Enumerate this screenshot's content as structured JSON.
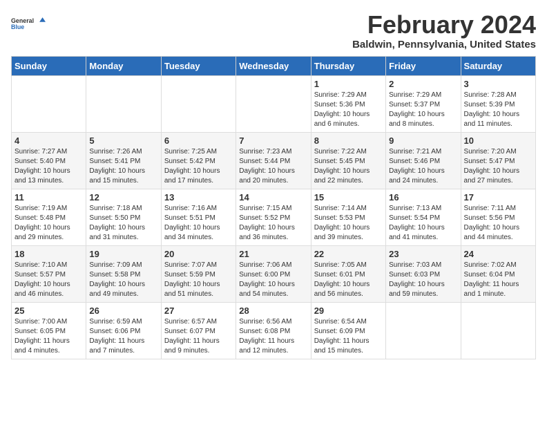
{
  "logo": {
    "line1": "General",
    "line2": "Blue"
  },
  "title": "February 2024",
  "subtitle": "Baldwin, Pennsylvania, United States",
  "headers": [
    "Sunday",
    "Monday",
    "Tuesday",
    "Wednesday",
    "Thursday",
    "Friday",
    "Saturday"
  ],
  "weeks": [
    [
      {
        "day": "",
        "info": ""
      },
      {
        "day": "",
        "info": ""
      },
      {
        "day": "",
        "info": ""
      },
      {
        "day": "",
        "info": ""
      },
      {
        "day": "1",
        "info": "Sunrise: 7:29 AM\nSunset: 5:36 PM\nDaylight: 10 hours\nand 6 minutes."
      },
      {
        "day": "2",
        "info": "Sunrise: 7:29 AM\nSunset: 5:37 PM\nDaylight: 10 hours\nand 8 minutes."
      },
      {
        "day": "3",
        "info": "Sunrise: 7:28 AM\nSunset: 5:39 PM\nDaylight: 10 hours\nand 11 minutes."
      }
    ],
    [
      {
        "day": "4",
        "info": "Sunrise: 7:27 AM\nSunset: 5:40 PM\nDaylight: 10 hours\nand 13 minutes."
      },
      {
        "day": "5",
        "info": "Sunrise: 7:26 AM\nSunset: 5:41 PM\nDaylight: 10 hours\nand 15 minutes."
      },
      {
        "day": "6",
        "info": "Sunrise: 7:25 AM\nSunset: 5:42 PM\nDaylight: 10 hours\nand 17 minutes."
      },
      {
        "day": "7",
        "info": "Sunrise: 7:23 AM\nSunset: 5:44 PM\nDaylight: 10 hours\nand 20 minutes."
      },
      {
        "day": "8",
        "info": "Sunrise: 7:22 AM\nSunset: 5:45 PM\nDaylight: 10 hours\nand 22 minutes."
      },
      {
        "day": "9",
        "info": "Sunrise: 7:21 AM\nSunset: 5:46 PM\nDaylight: 10 hours\nand 24 minutes."
      },
      {
        "day": "10",
        "info": "Sunrise: 7:20 AM\nSunset: 5:47 PM\nDaylight: 10 hours\nand 27 minutes."
      }
    ],
    [
      {
        "day": "11",
        "info": "Sunrise: 7:19 AM\nSunset: 5:48 PM\nDaylight: 10 hours\nand 29 minutes."
      },
      {
        "day": "12",
        "info": "Sunrise: 7:18 AM\nSunset: 5:50 PM\nDaylight: 10 hours\nand 31 minutes."
      },
      {
        "day": "13",
        "info": "Sunrise: 7:16 AM\nSunset: 5:51 PM\nDaylight: 10 hours\nand 34 minutes."
      },
      {
        "day": "14",
        "info": "Sunrise: 7:15 AM\nSunset: 5:52 PM\nDaylight: 10 hours\nand 36 minutes."
      },
      {
        "day": "15",
        "info": "Sunrise: 7:14 AM\nSunset: 5:53 PM\nDaylight: 10 hours\nand 39 minutes."
      },
      {
        "day": "16",
        "info": "Sunrise: 7:13 AM\nSunset: 5:54 PM\nDaylight: 10 hours\nand 41 minutes."
      },
      {
        "day": "17",
        "info": "Sunrise: 7:11 AM\nSunset: 5:56 PM\nDaylight: 10 hours\nand 44 minutes."
      }
    ],
    [
      {
        "day": "18",
        "info": "Sunrise: 7:10 AM\nSunset: 5:57 PM\nDaylight: 10 hours\nand 46 minutes."
      },
      {
        "day": "19",
        "info": "Sunrise: 7:09 AM\nSunset: 5:58 PM\nDaylight: 10 hours\nand 49 minutes."
      },
      {
        "day": "20",
        "info": "Sunrise: 7:07 AM\nSunset: 5:59 PM\nDaylight: 10 hours\nand 51 minutes."
      },
      {
        "day": "21",
        "info": "Sunrise: 7:06 AM\nSunset: 6:00 PM\nDaylight: 10 hours\nand 54 minutes."
      },
      {
        "day": "22",
        "info": "Sunrise: 7:05 AM\nSunset: 6:01 PM\nDaylight: 10 hours\nand 56 minutes."
      },
      {
        "day": "23",
        "info": "Sunrise: 7:03 AM\nSunset: 6:03 PM\nDaylight: 10 hours\nand 59 minutes."
      },
      {
        "day": "24",
        "info": "Sunrise: 7:02 AM\nSunset: 6:04 PM\nDaylight: 11 hours\nand 1 minute."
      }
    ],
    [
      {
        "day": "25",
        "info": "Sunrise: 7:00 AM\nSunset: 6:05 PM\nDaylight: 11 hours\nand 4 minutes."
      },
      {
        "day": "26",
        "info": "Sunrise: 6:59 AM\nSunset: 6:06 PM\nDaylight: 11 hours\nand 7 minutes."
      },
      {
        "day": "27",
        "info": "Sunrise: 6:57 AM\nSunset: 6:07 PM\nDaylight: 11 hours\nand 9 minutes."
      },
      {
        "day": "28",
        "info": "Sunrise: 6:56 AM\nSunset: 6:08 PM\nDaylight: 11 hours\nand 12 minutes."
      },
      {
        "day": "29",
        "info": "Sunrise: 6:54 AM\nSunset: 6:09 PM\nDaylight: 11 hours\nand 15 minutes."
      },
      {
        "day": "",
        "info": ""
      },
      {
        "day": "",
        "info": ""
      }
    ]
  ]
}
